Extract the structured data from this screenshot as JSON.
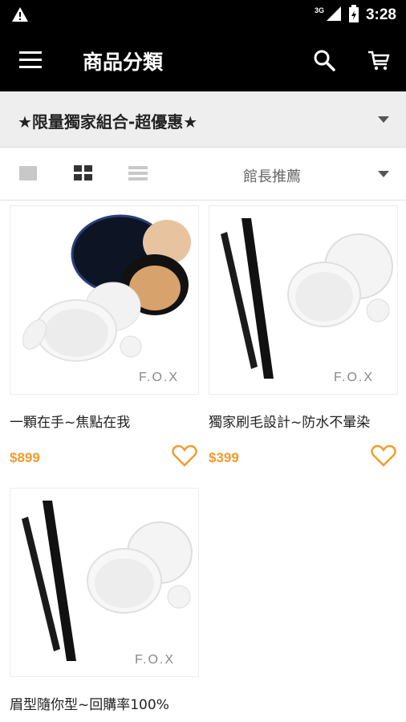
{
  "status_bar": {
    "time": "3:28",
    "network": "3G",
    "warning_icon": "warning-triangle-icon",
    "signal_icon": "signal-icon",
    "battery_icon": "battery-icon"
  },
  "app_bar": {
    "title": "商品分類",
    "menu_icon": "hamburger-menu-icon",
    "search_icon": "search-icon",
    "cart_icon": "shopping-cart-icon"
  },
  "category": {
    "selected": "★限量獨家組合-超優惠★",
    "dropdown_icon": "dropdown-arrow-icon"
  },
  "toolbar": {
    "sort_selected": "館長推薦",
    "view_modes": [
      "single-view-icon",
      "grid-view-icon",
      "list-view-icon"
    ],
    "active_view": "grid"
  },
  "colors": {
    "appbar_bg": "#000000",
    "price": "#f39a2b",
    "category_bg": "#eeeeee"
  },
  "products": [
    {
      "name": "一顆在手~焦點在我",
      "price": "$899",
      "brand": "F.O.X",
      "favorite_icon": "heart-outline-icon"
    },
    {
      "name": "獨家刷毛設計~防水不暈染",
      "price": "$399",
      "brand": "F.O.X",
      "favorite_icon": "heart-outline-icon"
    },
    {
      "name": "眉型隨你型~回購率100%",
      "price": "",
      "brand": "F.O.X",
      "favorite_icon": ""
    }
  ]
}
